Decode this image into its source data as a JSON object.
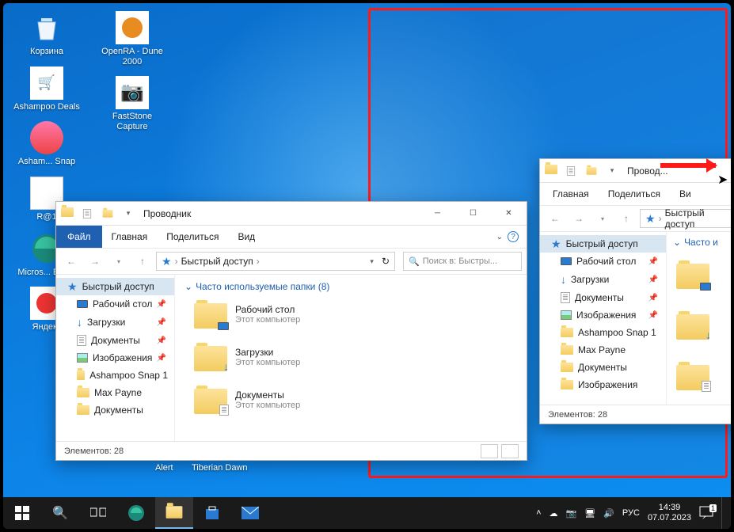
{
  "desktop_icons_col1": [
    {
      "label": "Корзина",
      "name": "recycle-bin-icon"
    },
    {
      "label": "Ashampoo Deals",
      "name": "ashampoo-deals-icon"
    },
    {
      "label": "Asham... Snap",
      "name": "ashampoo-snap-icon"
    },
    {
      "label": "R@1",
      "name": "rat1-icon"
    },
    {
      "label": "Micros... Edg...",
      "name": "edge-icon"
    },
    {
      "label": "Яндекс",
      "name": "yandex-icon"
    }
  ],
  "desktop_icons_col2": [
    {
      "label": "OpenRA - Dune 2000",
      "name": "openra-dune-icon"
    },
    {
      "label": "FastStone Capture",
      "name": "faststone-icon"
    }
  ],
  "partial_icons": [
    "Alert",
    "Tiberian Dawn"
  ],
  "explorer1": {
    "title": "Проводник",
    "tabs": {
      "file": "Файл",
      "home": "Главная",
      "share": "Поделиться",
      "view": "Вид"
    },
    "address": "Быстрый доступ",
    "search_placeholder": "Поиск в: Быстры...",
    "section_header": "Часто используемые папки (8)",
    "nav": [
      {
        "label": "Быстрый доступ",
        "type": "star",
        "active": true,
        "pin": false
      },
      {
        "label": "Рабочий стол",
        "type": "monitor",
        "pin": true
      },
      {
        "label": "Загрузки",
        "type": "download",
        "pin": true
      },
      {
        "label": "Документы",
        "type": "doc",
        "pin": true
      },
      {
        "label": "Изображения",
        "type": "img",
        "pin": true
      },
      {
        "label": "Ashampoo Snap 1",
        "type": "folder",
        "pin": false
      },
      {
        "label": "Max Payne",
        "type": "folder",
        "pin": false
      },
      {
        "label": "Документы",
        "type": "folder",
        "pin": false
      }
    ],
    "folders": [
      {
        "name": "Рабочий стол",
        "loc": "Этот компьютер",
        "overlay": "monitor"
      },
      {
        "name": "Загрузки",
        "loc": "Этот компьютер",
        "overlay": "download"
      },
      {
        "name": "Документы",
        "loc": "Этот компьютер",
        "overlay": "doc"
      }
    ],
    "status": "Элементов: 28"
  },
  "explorer2": {
    "title": "Провод...",
    "tabs": {
      "home": "Главная",
      "share": "Поделиться",
      "view": "Ви"
    },
    "address": "Быстрый доступ",
    "section_header": "Часто и",
    "nav": [
      {
        "label": "Быстрый доступ",
        "type": "star",
        "active": true,
        "pin": false
      },
      {
        "label": "Рабочий стол",
        "type": "monitor",
        "pin": true
      },
      {
        "label": "Загрузки",
        "type": "download",
        "pin": true
      },
      {
        "label": "Документы",
        "type": "doc",
        "pin": true
      },
      {
        "label": "Изображения",
        "type": "img",
        "pin": true
      },
      {
        "label": "Ashampoo Snap 1",
        "type": "folder",
        "pin": false
      },
      {
        "label": "Max Payne",
        "type": "folder",
        "pin": false
      },
      {
        "label": "Документы",
        "type": "folder",
        "pin": false
      },
      {
        "label": "Изображения",
        "type": "folder",
        "pin": false
      }
    ],
    "status": "Элементов: 28"
  },
  "taskbar": {
    "lang": "РУС",
    "time": "14:39",
    "date": "07.07.2023",
    "notif": "1"
  }
}
